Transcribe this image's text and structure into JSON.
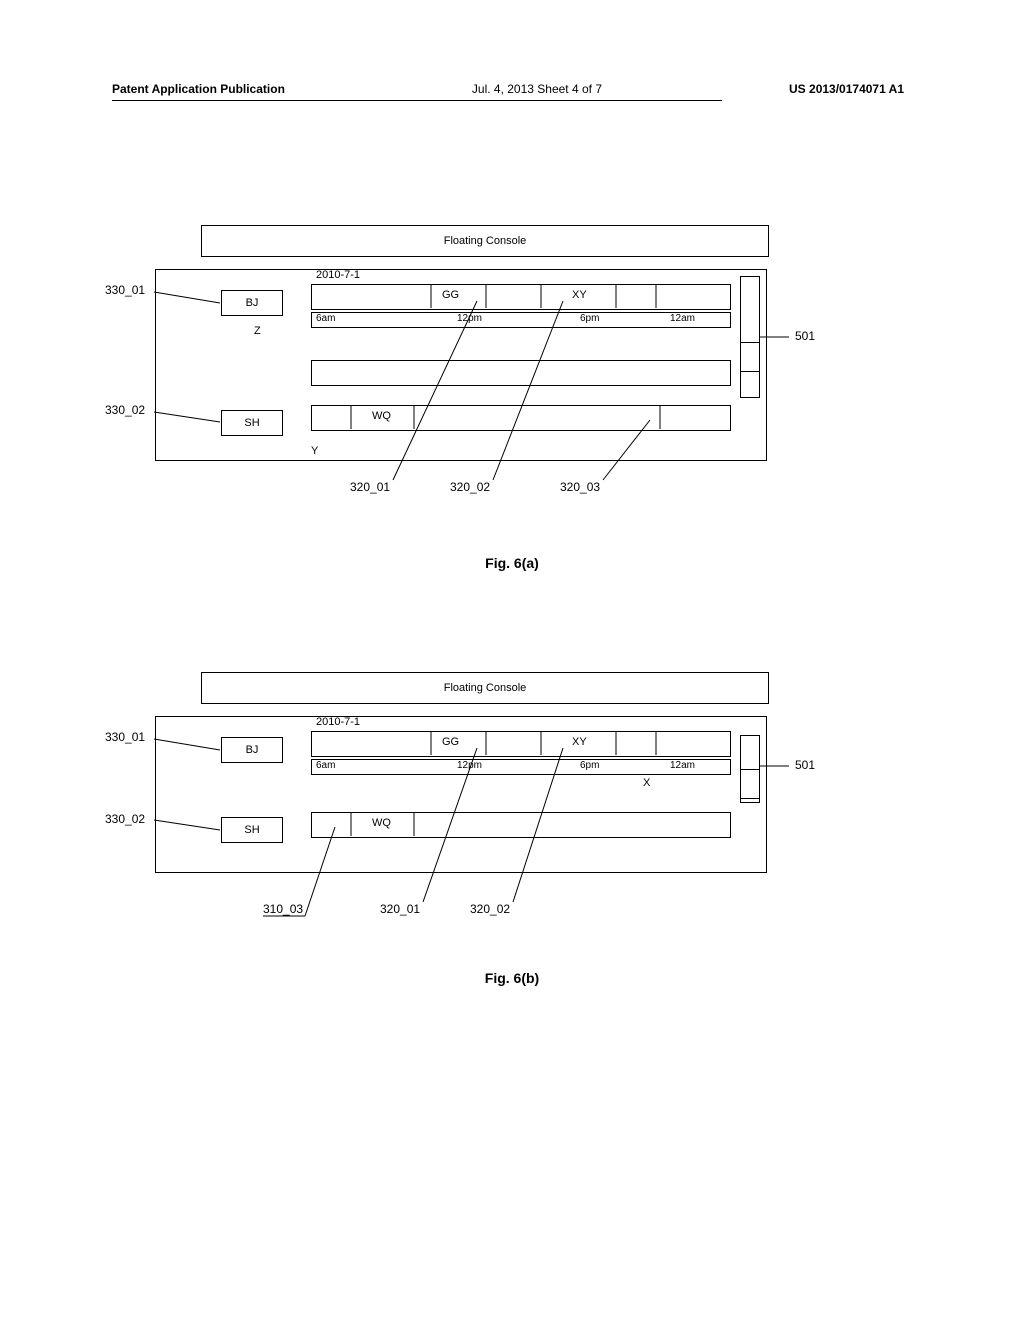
{
  "header": {
    "left": "Patent Application Publication",
    "center": "Jul. 4, 2013   Sheet 4 of 7",
    "right": "US 2013/0174071 A1"
  },
  "fig6a": {
    "console_title": "Floating Console",
    "date": "2010-7-1",
    "rows": {
      "bj": "BJ",
      "bj_secondary": "Z",
      "sh": "SH",
      "sh_secondary": "Y"
    },
    "events": {
      "gg": "GG",
      "xy": "XY",
      "wq": "WQ"
    },
    "timescale": [
      "6am",
      "12pm",
      "6pm",
      "12am"
    ],
    "refs": {
      "r330_01": "330_01",
      "r330_02": "330_02",
      "r320_01": "320_01",
      "r320_02": "320_02",
      "r320_03": "320_03",
      "r501": "501"
    },
    "caption": "Fig. 6(a)"
  },
  "fig6b": {
    "console_title": "Floating Console",
    "date": "2010-7-1",
    "rows": {
      "bj": "BJ",
      "sh": "SH"
    },
    "events": {
      "gg": "GG",
      "xy": "XY",
      "wq": "WQ",
      "x_note": "X"
    },
    "timescale": [
      "6am",
      "12pm",
      "6pm",
      "12am"
    ],
    "refs": {
      "r330_01": "330_01",
      "r330_02": "330_02",
      "r310_03": "310_03",
      "r320_01": "320_01",
      "r320_02": "320_02",
      "r501": "501"
    },
    "caption": "Fig. 6(b)"
  }
}
